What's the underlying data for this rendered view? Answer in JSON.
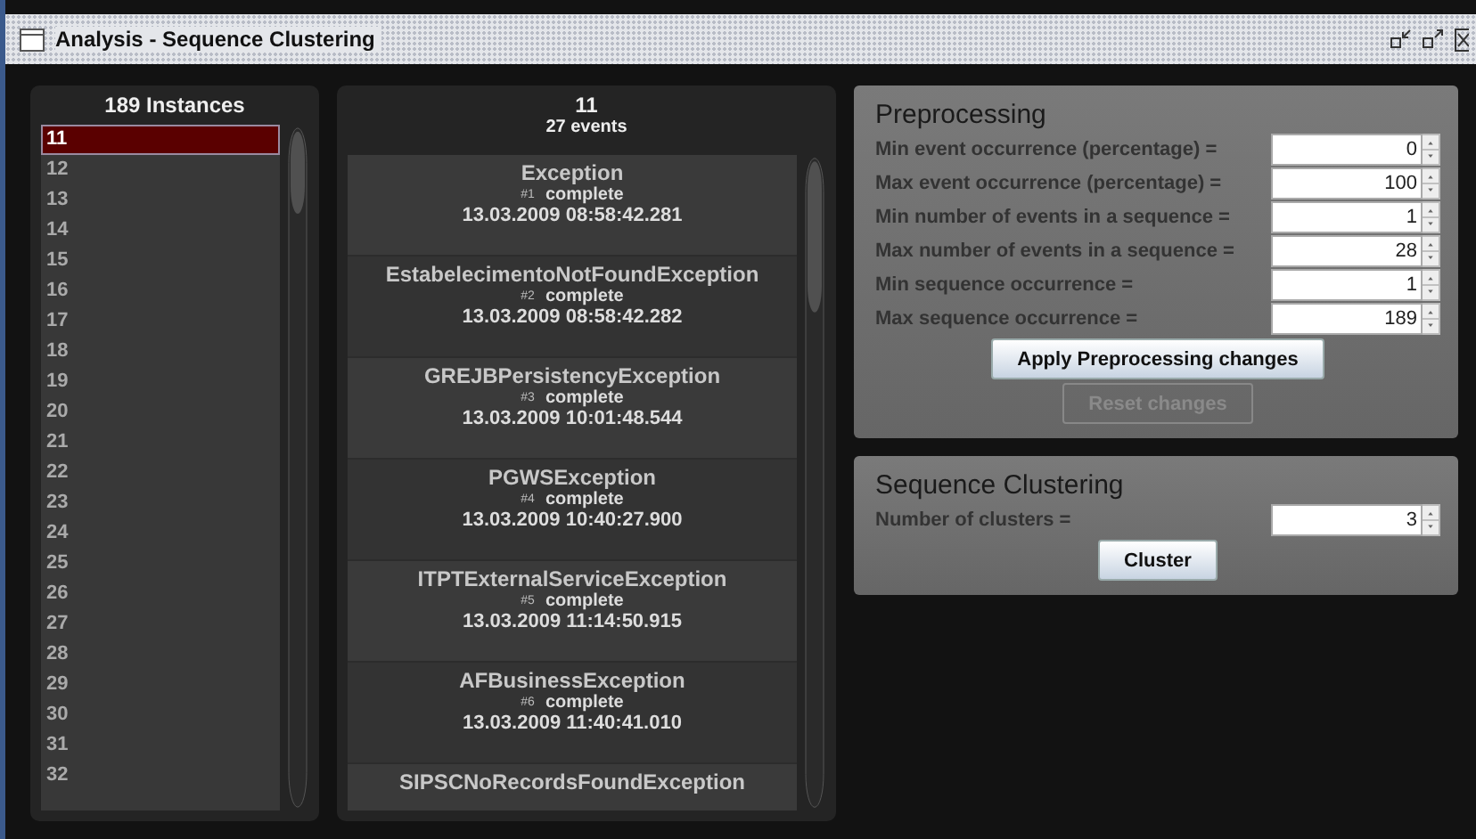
{
  "window": {
    "title": "Analysis - Sequence Clustering"
  },
  "instances": {
    "title": "189 Instances",
    "items": [
      {
        "label": "11",
        "selected": true
      },
      {
        "label": "12",
        "selected": false
      },
      {
        "label": "13",
        "selected": false
      },
      {
        "label": "14",
        "selected": false
      },
      {
        "label": "15",
        "selected": false
      },
      {
        "label": "16",
        "selected": false
      },
      {
        "label": "17",
        "selected": false
      },
      {
        "label": "18",
        "selected": false
      },
      {
        "label": "19",
        "selected": false
      },
      {
        "label": "20",
        "selected": false
      },
      {
        "label": "21",
        "selected": false
      },
      {
        "label": "22",
        "selected": false
      },
      {
        "label": "23",
        "selected": false
      },
      {
        "label": "24",
        "selected": false
      },
      {
        "label": "25",
        "selected": false
      },
      {
        "label": "26",
        "selected": false
      },
      {
        "label": "27",
        "selected": false
      },
      {
        "label": "28",
        "selected": false
      },
      {
        "label": "29",
        "selected": false
      },
      {
        "label": "30",
        "selected": false
      },
      {
        "label": "31",
        "selected": false
      },
      {
        "label": "32",
        "selected": false
      }
    ]
  },
  "sequence": {
    "title": "11",
    "subtitle": "27 events",
    "events": [
      {
        "name": "Exception",
        "index": "#1",
        "status": "complete",
        "time": "13.03.2009 08:58:42.281"
      },
      {
        "name": "EstabelecimentoNotFoundException",
        "index": "#2",
        "status": "complete",
        "time": "13.03.2009 08:58:42.282"
      },
      {
        "name": "GREJBPersistencyException",
        "index": "#3",
        "status": "complete",
        "time": "13.03.2009 10:01:48.544"
      },
      {
        "name": "PGWSException",
        "index": "#4",
        "status": "complete",
        "time": "13.03.2009 10:40:27.900"
      },
      {
        "name": "ITPTExternalServiceException",
        "index": "#5",
        "status": "complete",
        "time": "13.03.2009 11:14:50.915"
      },
      {
        "name": "AFBusinessException",
        "index": "#6",
        "status": "complete",
        "time": "13.03.2009 11:40:41.010"
      },
      {
        "name": "SIPSCNoRecordsFoundException"
      }
    ]
  },
  "preprocessing": {
    "title": "Preprocessing",
    "fields": [
      {
        "label": "Min event occurrence (percentage) =",
        "value": "0"
      },
      {
        "label": "Max event occurrence (percentage) =",
        "value": "100"
      },
      {
        "label": "Min number of events in a sequence =",
        "value": "1"
      },
      {
        "label": "Max number of events in a sequence =",
        "value": "28"
      },
      {
        "label": "Min sequence occurrence =",
        "value": "1"
      },
      {
        "label": "Max sequence occurrence =",
        "value": "189"
      }
    ],
    "buttons": [
      {
        "label": "Apply Preprocessing changes",
        "disabled": false
      },
      {
        "label": "Reset changes",
        "disabled": true
      }
    ]
  },
  "clustering": {
    "title": "Sequence Clustering",
    "fields": [
      {
        "label": "Number of clusters =",
        "value": "3"
      }
    ],
    "buttons": [
      {
        "label": "Cluster",
        "disabled": false
      }
    ]
  }
}
